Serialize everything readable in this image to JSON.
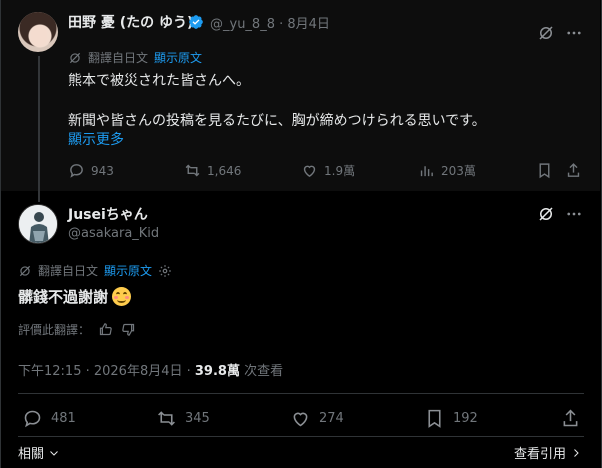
{
  "parent_tweet": {
    "name": "田野 憂 (たの ゆう)",
    "handle_date": "@_yu_8_8 · 8月4日",
    "translate_label": "翻譯自日文",
    "show_original": "顯示原文",
    "text_line1": "熊本で被災された皆さんへ。",
    "text_line2": "新聞や皆さんの投稿を見るたびに、胸が締めつけられる思いです。",
    "show_more": "顯示更多",
    "actions": {
      "replies": "943",
      "reposts": "1,646",
      "likes": "1.9萬",
      "views": "203萬"
    }
  },
  "main_tweet": {
    "name": "Juseiちゃん",
    "handle": "@asakara_Kid",
    "translate_label": "翻譯自日文",
    "show_original": "顯示原文",
    "text": "髒錢不過謝謝",
    "rate_label": "評價此翻譯：",
    "time_date": "下午12:15 · 2026年8月4日 · ",
    "views_count": "39.8萬",
    "views_label": " 次查看",
    "actions": {
      "replies": "481",
      "reposts": "345",
      "likes": "274",
      "bookmarks": "192"
    },
    "related_label": "相關",
    "view_quotes_label": "查看引用"
  },
  "icons": {
    "verified": "verified-badge-icon",
    "grok": "grok-icon",
    "more": "more-icon",
    "reply": "reply-icon",
    "repost": "repost-icon",
    "like": "like-icon",
    "views": "views-icon",
    "bookmark": "bookmark-icon",
    "share": "share-icon",
    "settings": "gear-icon",
    "thumb_up": "thumb-up-icon",
    "thumb_down": "thumb-down-icon",
    "chevron_down": "chevron-down-icon",
    "chevron_right": "chevron-right-icon"
  },
  "colors": {
    "accent": "#1d9bf0",
    "muted": "#71767b",
    "text": "#e7e9ea",
    "background": "#000000"
  }
}
